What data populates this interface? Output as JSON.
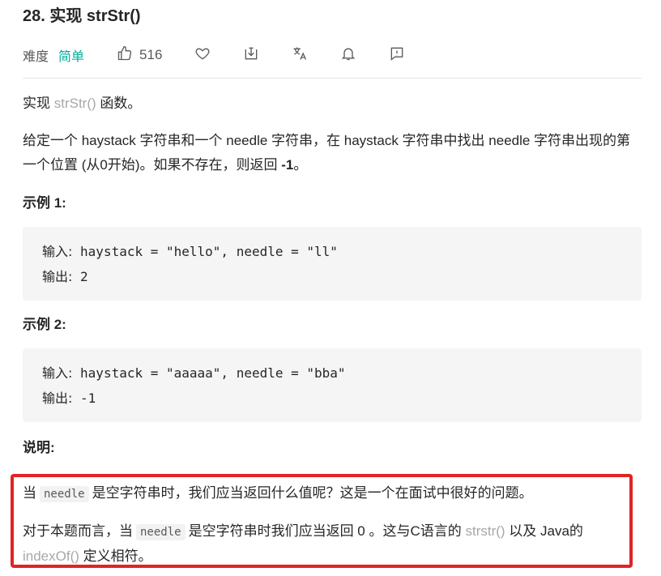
{
  "problem": {
    "title": "28. 实现 strStr()"
  },
  "meta": {
    "difficulty_label": "难度",
    "difficulty_value": "简单",
    "likes": "516",
    "icons": [
      "thumbs-up-icon",
      "heart-icon",
      "share-icon",
      "translate-icon",
      "bell-icon",
      "feedback-icon"
    ],
    "colors": {
      "difficulty_easy": "#00af9b"
    }
  },
  "description": {
    "intro_prefix": "实现 ",
    "intro_link": "strStr()",
    "intro_suffix": " 函数。",
    "para2_main": "给定一个 haystack 字符串和一个 needle 字符串，在 haystack 字符串中找出 needle 字符串出现的第一个位置 (从0开始)。如果不存在，则返回  ",
    "para2_bold": "-1",
    "para2_end": "。"
  },
  "examples": [
    {
      "heading": "示例 1:",
      "input_label": "输入:",
      "input_value": " haystack = \"hello\", needle = \"ll\"",
      "output_label": "输出:",
      "output_value": " 2"
    },
    {
      "heading": "示例 2:",
      "input_label": "输入:",
      "input_value": " haystack = \"aaaaa\", needle = \"bba\"",
      "output_label": "输出:",
      "output_value": " -1"
    }
  ],
  "note": {
    "heading": "说明:",
    "p1_prefix": "当",
    "p1_code": "needle",
    "p1_suffix": "是空字符串时，我们应当返回什么值呢？这是一个在面试中很好的问题。",
    "p2_prefix": "对于本题而言，当",
    "p2_code": "needle",
    "p2_mid": "是空字符串时我们应当返回 0 。这与C语言的 ",
    "p2_link1": "strstr()",
    "p2_mid2": " 以及 Java的 ",
    "p2_link2": "indexOf()",
    "p2_end": " 定义相符。",
    "highlight_color": "#e02424"
  }
}
